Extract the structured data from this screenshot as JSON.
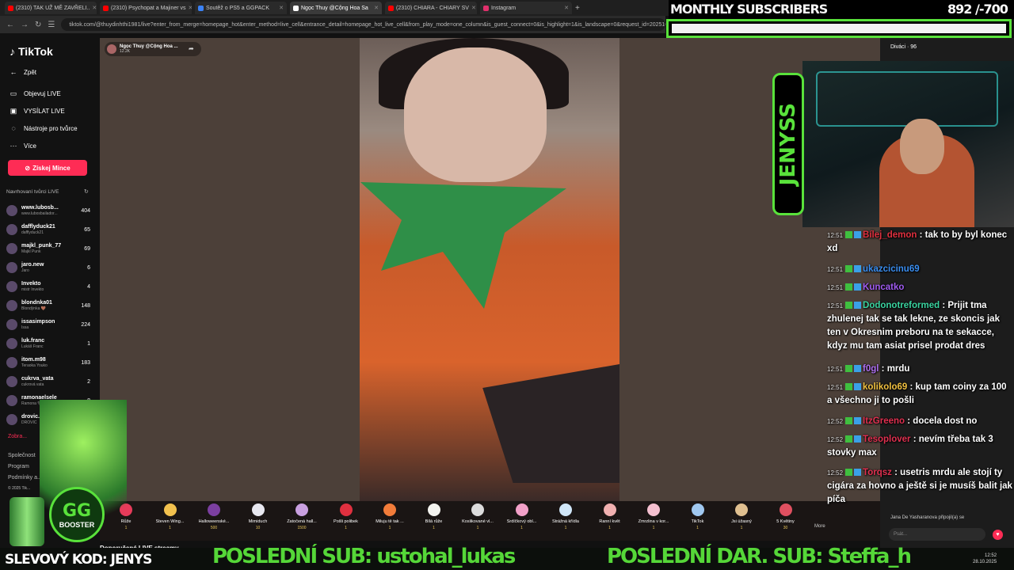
{
  "browser": {
    "tabs": [
      {
        "title": "(2310) TAK UŽ MĚ ZAVŘELI..",
        "color": "#ff0000"
      },
      {
        "title": "(2310) Psychopat a Majiner vs",
        "color": "#ff0000"
      },
      {
        "title": "Soutěž o PS5 a GGPACK",
        "color": "#3b82f6"
      },
      {
        "title": "Ngọc Thuy @Cộng Hoa Sa",
        "color": "#ffffff"
      },
      {
        "title": "(2310) CHIARA - CHIARY SV",
        "color": "#ff0000"
      },
      {
        "title": "Instagram",
        "color": "#e1306c"
      }
    ],
    "url": "tiktok.com/@thuydinhthi1981/live?enter_from_merge=homepage_hot&enter_method=live_cell&entrance_detail=homepage_hot_live_cell&from_play_mode=one_column&is_guest_connect=0&is_highlight=1&is_landscape=0&request_id=2025102"
  },
  "sidebar": {
    "logo": "TikTok",
    "back": "Zpět",
    "menu": [
      "Objevuj LIVE",
      "VYSÍLAT LIVE",
      "Nástroje pro tvůrce",
      "Více"
    ],
    "coins_button": "Získej Mince",
    "recommended_title": "Navrhovaní tvůrci LIVE",
    "creators": [
      {
        "name": "www.lubosb...",
        "sub": "www.lubosbailador...",
        "count": "404"
      },
      {
        "name": "dafflyduck21",
        "sub": "dafflyduck21",
        "count": "65"
      },
      {
        "name": "majkl_punk_77",
        "sub": "Majkl Punk",
        "count": "69"
      },
      {
        "name": "jaro.new",
        "sub": "Jaro",
        "count": "6"
      },
      {
        "name": "Invekto",
        "sub": "mistr Invekto",
        "count": "4"
      },
      {
        "name": "blondnka01",
        "sub": "Blondýnka 🤎",
        "count": "148"
      },
      {
        "name": "issasimpson",
        "sub": "Issa",
        "count": "224"
      },
      {
        "name": "luk.franc",
        "sub": "Lukáš Franc",
        "count": "1"
      },
      {
        "name": "itom.m98",
        "sub": "Teraoka Youko",
        "count": "183"
      },
      {
        "name": "cukrva_vata",
        "sub": "cukrová vata",
        "count": "2"
      },
      {
        "name": "ramonaelsele",
        "sub": "Ramona 🖤 ROB...",
        "count": "8"
      },
      {
        "name": "drovic.vn",
        "sub": "DROVIC",
        "count": ""
      }
    ],
    "footer": [
      "Zobra...",
      "Společnost",
      "Program",
      "Podmínky a...",
      "© 2025 Tik..."
    ]
  },
  "stream": {
    "host_name": "Ngọc Thuy @Cộng Hoa ...",
    "viewers_small": "12.2K",
    "gifts": [
      {
        "name": "Růže",
        "price": "1",
        "color": "#e63b5a"
      },
      {
        "name": "Steven Wing...",
        "price": "1",
        "color": "#f2c14e"
      },
      {
        "name": "Halloweenské...",
        "price": "500",
        "color": "#7b3fa0"
      },
      {
        "name": "Mimiduch",
        "price": "10",
        "color": "#e8e8f0"
      },
      {
        "name": "Zatočená hall...",
        "price": "1500",
        "color": "#c9a0e0"
      },
      {
        "name": "Pošli polibek",
        "price": "1",
        "color": "#e0303f"
      },
      {
        "name": "Miluju tě tak ...",
        "price": "1",
        "color": "#f27c3a"
      },
      {
        "name": "Bílá růže",
        "price": "1",
        "color": "#f4f4f0"
      },
      {
        "name": "Koslikované vl...",
        "price": "1",
        "color": "#dcdcdc"
      },
      {
        "name": "Srdíčkový obl...",
        "price": "1",
        "color": "#f2a0c8"
      },
      {
        "name": "Strážná křídla",
        "price": "1",
        "color": "#d0e6f8"
      },
      {
        "name": "Ranní květ",
        "price": "1",
        "color": "#f0b0b0"
      },
      {
        "name": "Zmrzlina v kor...",
        "price": "1",
        "color": "#f5c0d0"
      },
      {
        "name": "TikTok",
        "price": "1",
        "color": "#a0c8f0"
      },
      {
        "name": "Jsi úžasný",
        "price": "1",
        "color": "#e0c090"
      },
      {
        "name": "5 Květiny",
        "price": "30",
        "color": "#e05060"
      }
    ],
    "more": "More",
    "recommended_bottom": "Doporučené LIVE streamy"
  },
  "tkchat": {
    "viewers": "Diváci · 96",
    "joined": "Jana De Yasharanova  připojil(a) se",
    "input_placeholder": "Psát..."
  },
  "overlay": {
    "monthly_title": "MONTHLY SUBSCRIBERS",
    "monthly_count": "892 /-700",
    "jenys": "JENYSS",
    "promo": "SLEVOVÝ KOD: JENYS",
    "last_sub": "POSLEDNÍ SUB: ustohal_lukas",
    "last_gift": "POSLEDNÍ DAR. SUB: Steffa_h",
    "sponsor_g": "GG",
    "sponsor_sub": "BOOSTER",
    "clock_time": "12:52",
    "clock_date": "28.10.2025",
    "chat": [
      {
        "time": "12:51",
        "user": "Bílej_demon",
        "color": "#e0303f",
        "text": " : tak to by byl konec xd"
      },
      {
        "time": "12:51",
        "user": "ukazcicinu69",
        "color": "#3a8ef0",
        "text": ""
      },
      {
        "time": "12:51",
        "user": "Kuncatko",
        "color": "#a05cf0",
        "text": ""
      },
      {
        "time": "12:51",
        "user": "Dodonotreformed",
        "color": "#3ad4a0",
        "text": " : Prijit tma zhulenej tak se tak lekne, ze skoncis jak ten v Okresnim preboru na te sekacce, kdyz mu tam asiat prisel prodat dres"
      },
      {
        "time": "12:51",
        "user": "f0gl",
        "color": "#b070f0",
        "text": " : mrdu"
      },
      {
        "time": "12:51",
        "user": "kolikolo69",
        "color": "#f0c040",
        "text": " : kup tam coiny za 100 a všechno ji to pošli"
      },
      {
        "time": "12:52",
        "user": "ItzGreeno",
        "color": "#e03050",
        "text": " : docela dost no"
      },
      {
        "time": "12:52",
        "user": "Tesoplover",
        "color": "#e03050",
        "text": " : nevím třeba tak 3 stovky max"
      },
      {
        "time": "12:52",
        "user": "Torqsz",
        "color": "#e03050",
        "text": " : usetris mrdu ale stojí ty cigára za hovno a ještě si je musíš balit jak píča"
      }
    ]
  }
}
